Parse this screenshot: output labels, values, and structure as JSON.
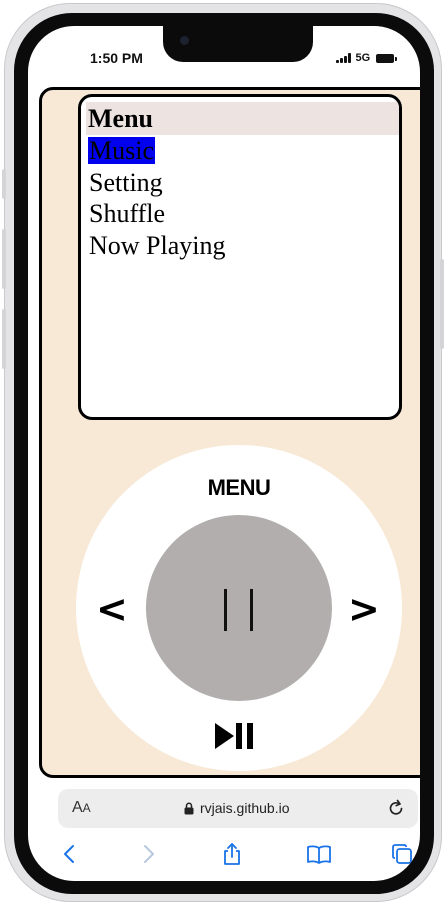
{
  "status_bar": {
    "time": "1:50 PM",
    "network": "5G"
  },
  "ipod": {
    "screen": {
      "title": "Menu",
      "items": [
        {
          "label": "Music",
          "selected": true
        },
        {
          "label": "Setting",
          "selected": false
        },
        {
          "label": "Shuffle",
          "selected": false
        },
        {
          "label": "Now Playing",
          "selected": false
        }
      ]
    },
    "wheel": {
      "menu_label": "MENU",
      "prev_label": "<",
      "next_label": ">"
    }
  },
  "browser": {
    "text_size_label": "A",
    "text_size_label_small": "A",
    "url": "rvjais.github.io"
  },
  "colors": {
    "app_background": "#f8e9d7",
    "selection": "#0000ee",
    "header_background": "#ede4e2",
    "wheel_center": "#b2aeae",
    "browser_accent": "#1a73e8"
  },
  "icons": [
    "lock-icon",
    "reload-icon",
    "back-icon",
    "forward-icon",
    "share-icon",
    "bookmarks-icon",
    "tabs-icon",
    "play-pause-icon",
    "pause-icon"
  ]
}
